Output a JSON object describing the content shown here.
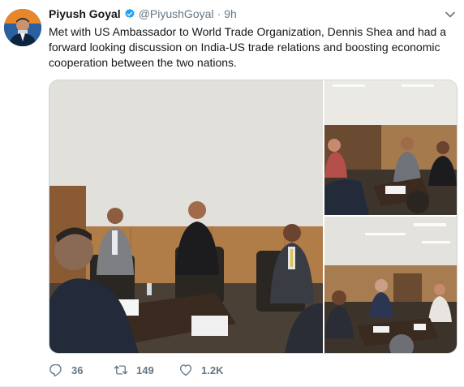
{
  "tweet": {
    "display_name": "Piyush Goyal",
    "handle": "@PiyushGoyal",
    "separator": "·",
    "time": "9h",
    "verified": true,
    "text": "Met with US Ambassador to World Trade Organization, Dennis Shea and had a forward looking discussion on India-US trade relations and boosting economic cooperation between the two nations.",
    "media": [
      {
        "name": "meeting-photo-main"
      },
      {
        "name": "meeting-photo-top-right"
      },
      {
        "name": "meeting-photo-bottom-right"
      }
    ],
    "actions": {
      "reply_icon": "reply-icon",
      "reply_count": "36",
      "retweet_icon": "retweet-icon",
      "retweet_count": "149",
      "like_icon": "heart-icon",
      "like_count": "1.2K"
    }
  },
  "colors": {
    "text": "#14171a",
    "secondary": "#657786",
    "verified": "#1da1f2",
    "border": "#e6ecf0"
  }
}
